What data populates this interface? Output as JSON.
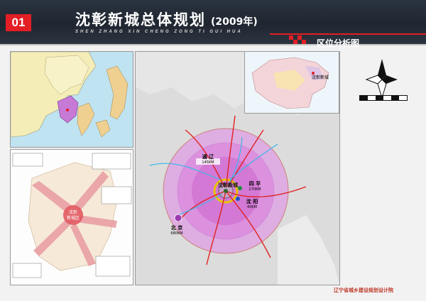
{
  "header": {
    "number": "01",
    "title": "沈彰新城总体规划",
    "year": "(2009年)",
    "subtitle": "SHEN ZHANG XIN CHENG ZONG TI GUI HUA"
  },
  "section_title": "区位分析图",
  "main_map": {
    "cities": [
      {
        "name": "通 辽",
        "dist": "145KM"
      },
      {
        "name": "四 平",
        "dist": "170KM"
      },
      {
        "name": "沈彰新城",
        "dist": ""
      },
      {
        "name": "沈 阳",
        "dist": "40KM"
      },
      {
        "name": "北 京",
        "dist": "680KM"
      }
    ]
  },
  "china_map": {
    "label": "沈彰新城"
  },
  "region_map": {
    "center_label_1": "沈彰",
    "center_label_2": "新城区"
  },
  "footer": {
    "logo_text": "辽宁省城乡建设规划设计院"
  },
  "colors": {
    "accent": "#e31e24",
    "header": "#1f2630",
    "circle_fill": "#d45bd8",
    "roads": "#e02020",
    "rivers": "#38b6e8"
  }
}
